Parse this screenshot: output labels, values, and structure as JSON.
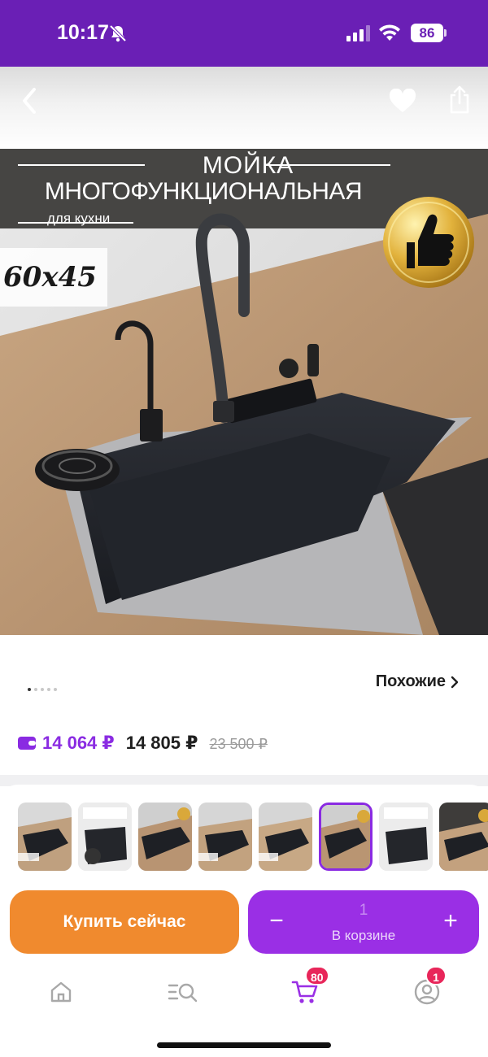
{
  "status_bar": {
    "time": "10:17",
    "battery": "86"
  },
  "product_image": {
    "title_line1": "МОЙКА",
    "title_line2": "МНОГОФУНКЦИОНАЛЬНАЯ",
    "subtitle": "для кухни",
    "size_badge": "60x45"
  },
  "gallery": {
    "page_count": 5,
    "active_page": 1
  },
  "similar_link": "Похожие",
  "prices": {
    "wallet_price": "14 064 ₽",
    "current_price": "14 805 ₽",
    "old_price": "23 500 ₽"
  },
  "thumbnails": {
    "count": 8,
    "selected_index": 5
  },
  "actions": {
    "buy_now_label": "Купить сейчас",
    "cart_quantity": "1",
    "in_cart_label": "В корзине",
    "minus_symbol": "−",
    "plus_symbol": "+"
  },
  "tab_bar": {
    "cart_badge": "80",
    "profile_badge": "1"
  },
  "colors": {
    "brand_purple": "#6a1fb5",
    "accent_purple": "#9a2fe5",
    "buy_orange": "#f08a2e",
    "badge_red": "#e8265a"
  }
}
